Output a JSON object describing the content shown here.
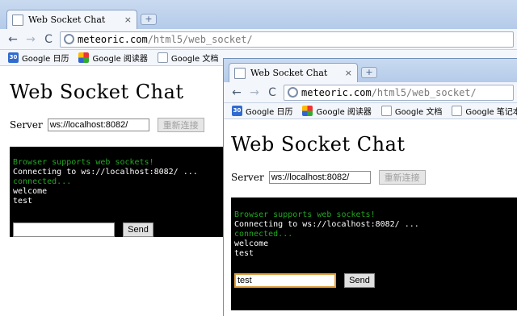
{
  "back_window": {
    "tab": {
      "title": "Web Socket Chat",
      "close": "×",
      "new_tab": "+"
    },
    "toolbar": {
      "back": "←",
      "forward": "→",
      "reload": "C"
    },
    "address": {
      "host": "meteoric.com",
      "path": "/html5/web_socket/"
    },
    "bookmarks": [
      {
        "icon": "calendar-icon",
        "badge": "30",
        "label": "Google 日历"
      },
      {
        "icon": "reader-icon",
        "label": "Google 阅读器"
      },
      {
        "icon": "document-icon",
        "label": "Google 文档"
      }
    ],
    "page": {
      "heading": "Web Socket Chat",
      "server_label": "Server",
      "server_value": "ws://localhost:8082/",
      "connect_label": "重新连接",
      "console_lines": [
        {
          "text": "Browser supports web sockets!",
          "color": "#22a822"
        },
        {
          "text": "Connecting to ws://localhost:8082/ ...",
          "color": "#ffffff"
        },
        {
          "text": "connected...",
          "color": "#22a822"
        },
        {
          "text": "welcome",
          "color": "#ffffff"
        },
        {
          "text": "test",
          "color": "#ffffff"
        }
      ],
      "message_value": "",
      "send_label": "Send"
    }
  },
  "front_window": {
    "tab": {
      "title": "Web Socket Chat",
      "close": "×",
      "new_tab": "+"
    },
    "toolbar": {
      "back": "←",
      "forward": "→",
      "reload": "C"
    },
    "address": {
      "host": "meteoric.com",
      "path": "/html5/web_socket/"
    },
    "bookmarks": [
      {
        "icon": "calendar-icon",
        "badge": "30",
        "label": "Google 日历"
      },
      {
        "icon": "reader-icon",
        "label": "Google 阅读器"
      },
      {
        "icon": "document-icon",
        "label": "Google 文档"
      },
      {
        "icon": "document-icon",
        "label": "Google 笔记本"
      }
    ],
    "page": {
      "heading": "Web Socket Chat",
      "server_label": "Server",
      "server_value": "ws://localhost:8082/",
      "connect_label": "重新连接",
      "console_lines": [
        {
          "text": "Browser supports web sockets!",
          "color": "#22a822"
        },
        {
          "text": "Connecting to ws://localhost:8082/ ...",
          "color": "#ffffff"
        },
        {
          "text": "connected...",
          "color": "#22a822"
        },
        {
          "text": "welcome",
          "color": "#ffffff"
        },
        {
          "text": "test",
          "color": "#ffffff"
        }
      ],
      "message_value": "test",
      "send_label": "Send"
    }
  }
}
